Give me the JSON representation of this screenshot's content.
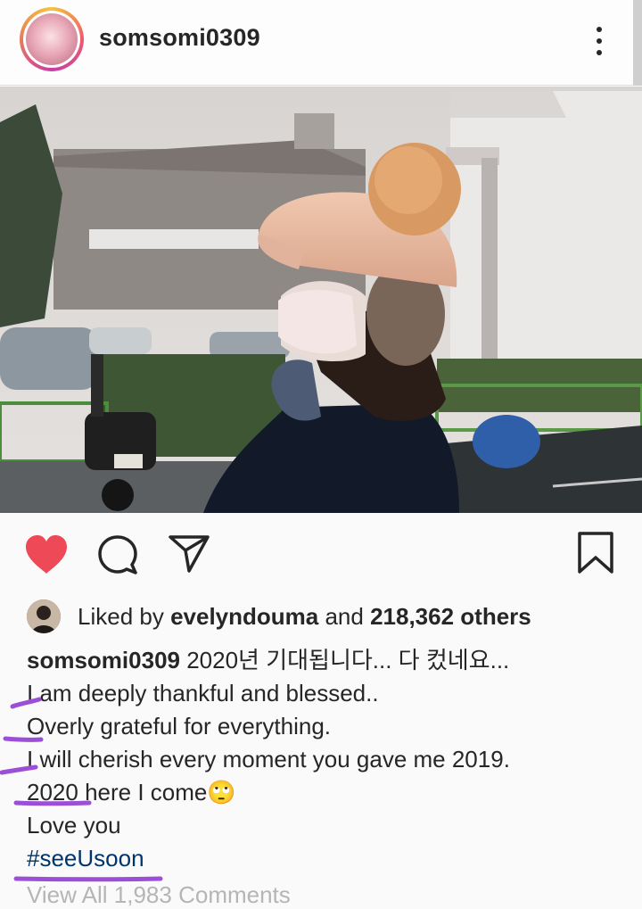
{
  "post": {
    "username": "somsomi0309",
    "liked_by_prefix": "Liked by ",
    "liked_by_user": "evelyndouma",
    "liked_by_mid": " and ",
    "liked_by_others": "218,362 others",
    "caption_username": "somsomi0309",
    "caption_first": " 2020년 기대됩니다... 다 컸네요...",
    "caption_lines": [
      "I am deeply thankful and blessed..",
      "Overly grateful for everything.",
      "I will cherish every moment you gave me 2019.",
      "2020 here I come",
      "Love you"
    ],
    "emoji": "🙄",
    "hashtag": "#seeUsoon",
    "view_all_comments": "View All 1,983 Comments"
  },
  "icons": {
    "more": "more-vertical-icon",
    "like": "heart-icon",
    "comment": "comment-icon",
    "share": "send-icon",
    "save": "bookmark-icon"
  },
  "colors": {
    "heart": "#ed4956",
    "hashtag": "#003569",
    "highlight_marks": "#9b4fd6"
  }
}
